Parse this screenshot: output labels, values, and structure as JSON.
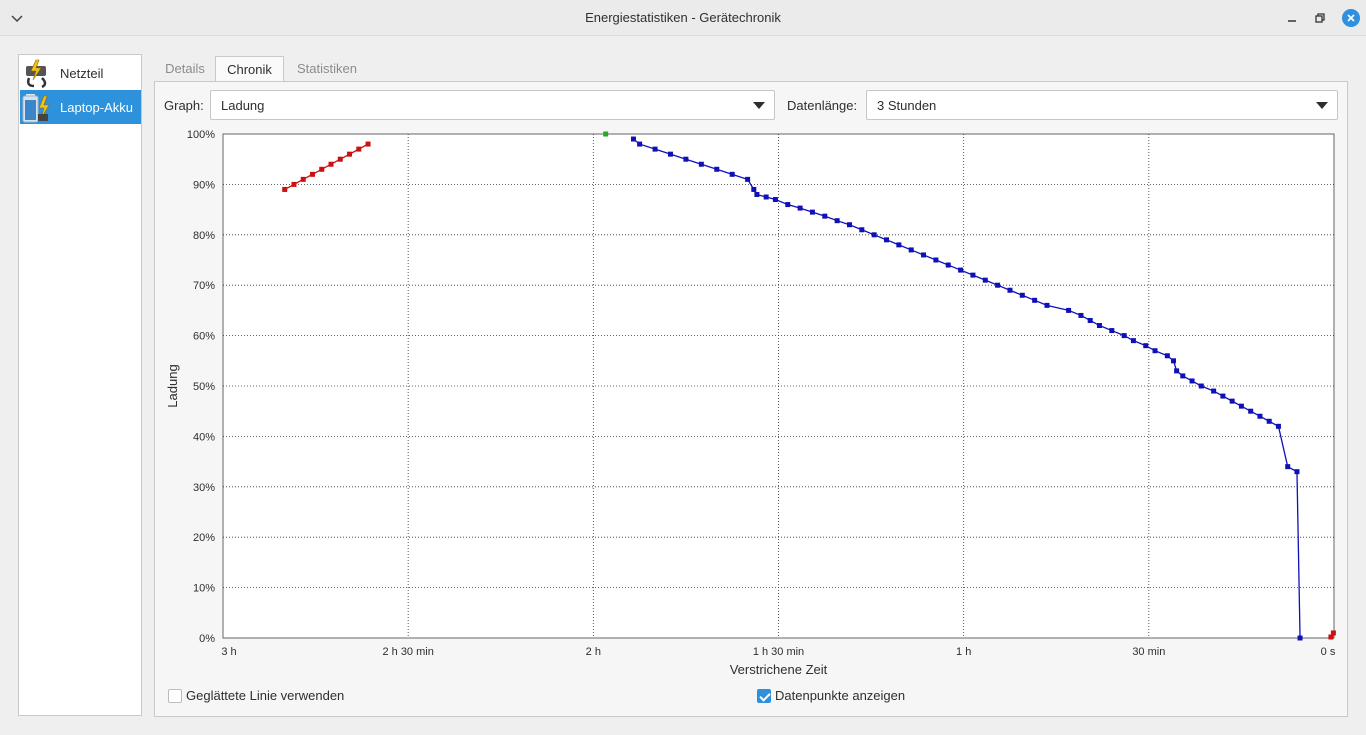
{
  "window": {
    "title": "Energiestatistiken - Gerätechronik"
  },
  "devices": [
    {
      "label": "Netzteil",
      "icon": "power-supply-icon",
      "selected": false
    },
    {
      "label": "Laptop-Akku",
      "icon": "battery-icon",
      "selected": true
    }
  ],
  "tabs": [
    {
      "label": "Details",
      "active": false
    },
    {
      "label": "Chronik",
      "active": true
    },
    {
      "label": "Statistiken",
      "active": false
    }
  ],
  "controls": {
    "graph_label": "Graph:",
    "graph_value": "Ladung",
    "length_label": "Datenlänge:",
    "length_value": "3 Stunden"
  },
  "options": {
    "smooth_label": "Geglättete Linie verwenden",
    "smooth_checked": false,
    "points_label": "Datenpunkte anzeigen",
    "points_checked": true
  },
  "colors": {
    "accent": "#2d92db",
    "charging": "#cc1010",
    "discharging": "#1010b8",
    "full": "#22aa22"
  },
  "chart_data": {
    "type": "line",
    "xlabel": "Verstrichene Zeit",
    "ylabel": "Ladung",
    "x_unit": "minutes elapsed (axis reversed, 3 h on left to 0 s on right)",
    "xlim": [
      180,
      0
    ],
    "ylim": [
      0,
      100
    ],
    "x_ticks": [
      {
        "value": 180,
        "label": "3 h"
      },
      {
        "value": 150,
        "label": "2 h 30 min"
      },
      {
        "value": 120,
        "label": "2 h"
      },
      {
        "value": 90,
        "label": "1 h 30 min"
      },
      {
        "value": 60,
        "label": "1 h"
      },
      {
        "value": 30,
        "label": "30 min"
      },
      {
        "value": 0,
        "label": "0 s"
      }
    ],
    "y_ticks": [
      {
        "value": 0,
        "label": "0%"
      },
      {
        "value": 10,
        "label": "10%"
      },
      {
        "value": 20,
        "label": "20%"
      },
      {
        "value": 30,
        "label": "30%"
      },
      {
        "value": 40,
        "label": "40%"
      },
      {
        "value": 50,
        "label": "50%"
      },
      {
        "value": 60,
        "label": "60%"
      },
      {
        "value": 70,
        "label": "70%"
      },
      {
        "value": 80,
        "label": "80%"
      },
      {
        "value": 90,
        "label": "90%"
      },
      {
        "value": 100,
        "label": "100%"
      }
    ],
    "grid": true,
    "series": [
      {
        "state": "charging",
        "color": "#cc1010",
        "points": [
          [
            170,
            89
          ],
          [
            168.5,
            90
          ],
          [
            167,
            91
          ],
          [
            165.5,
            92
          ],
          [
            164,
            93
          ],
          [
            162.5,
            94
          ],
          [
            161,
            95
          ],
          [
            159.5,
            96
          ],
          [
            158,
            97
          ],
          [
            156.5,
            98
          ]
        ]
      },
      {
        "state": "fully-charged",
        "color": "#22aa22",
        "points": [
          [
            118,
            101
          ]
        ]
      },
      {
        "state": "discharging",
        "color": "#1010b8",
        "points": [
          [
            113.5,
            99
          ],
          [
            112.5,
            98
          ],
          [
            110,
            97
          ],
          [
            107.5,
            96
          ],
          [
            105,
            95
          ],
          [
            102.5,
            94
          ],
          [
            100,
            93
          ],
          [
            97.5,
            92
          ],
          [
            95,
            91
          ],
          [
            94,
            89
          ],
          [
            93.5,
            88
          ],
          [
            92,
            87.5
          ],
          [
            90.5,
            87
          ],
          [
            88.5,
            86
          ],
          [
            86.5,
            85.3
          ],
          [
            84.5,
            84.5
          ],
          [
            82.5,
            83.7
          ],
          [
            80.5,
            82.8
          ],
          [
            78.5,
            82
          ],
          [
            76.5,
            81
          ],
          [
            74.5,
            80
          ],
          [
            72.5,
            79
          ],
          [
            70.5,
            78
          ],
          [
            68.5,
            77
          ],
          [
            66.5,
            76
          ],
          [
            64.5,
            75
          ],
          [
            62.5,
            74
          ],
          [
            60.5,
            73
          ],
          [
            58.5,
            72
          ],
          [
            56.5,
            71
          ],
          [
            54.5,
            70
          ],
          [
            52.5,
            69
          ],
          [
            50.5,
            68
          ],
          [
            48.5,
            67
          ],
          [
            46.5,
            66
          ],
          [
            43,
            65
          ],
          [
            41,
            64
          ],
          [
            39.5,
            63
          ],
          [
            38,
            62
          ],
          [
            36,
            61
          ],
          [
            34,
            60
          ],
          [
            32.5,
            59
          ],
          [
            30.5,
            58
          ],
          [
            29,
            57
          ],
          [
            27,
            56
          ],
          [
            26,
            55
          ],
          [
            25.5,
            53
          ],
          [
            24.5,
            52
          ],
          [
            23,
            51
          ],
          [
            21.5,
            50
          ],
          [
            19.5,
            49
          ],
          [
            18,
            48
          ],
          [
            16.5,
            47
          ],
          [
            15,
            46
          ],
          [
            13.5,
            45
          ],
          [
            12,
            44
          ],
          [
            10.5,
            43
          ],
          [
            9,
            42
          ],
          [
            7.5,
            34
          ],
          [
            6,
            33
          ],
          [
            5.5,
            0
          ]
        ]
      },
      {
        "state": "charging",
        "color": "#cc1010",
        "points": [
          [
            0.5,
            0.2
          ],
          [
            0.1,
            1
          ]
        ]
      }
    ]
  }
}
